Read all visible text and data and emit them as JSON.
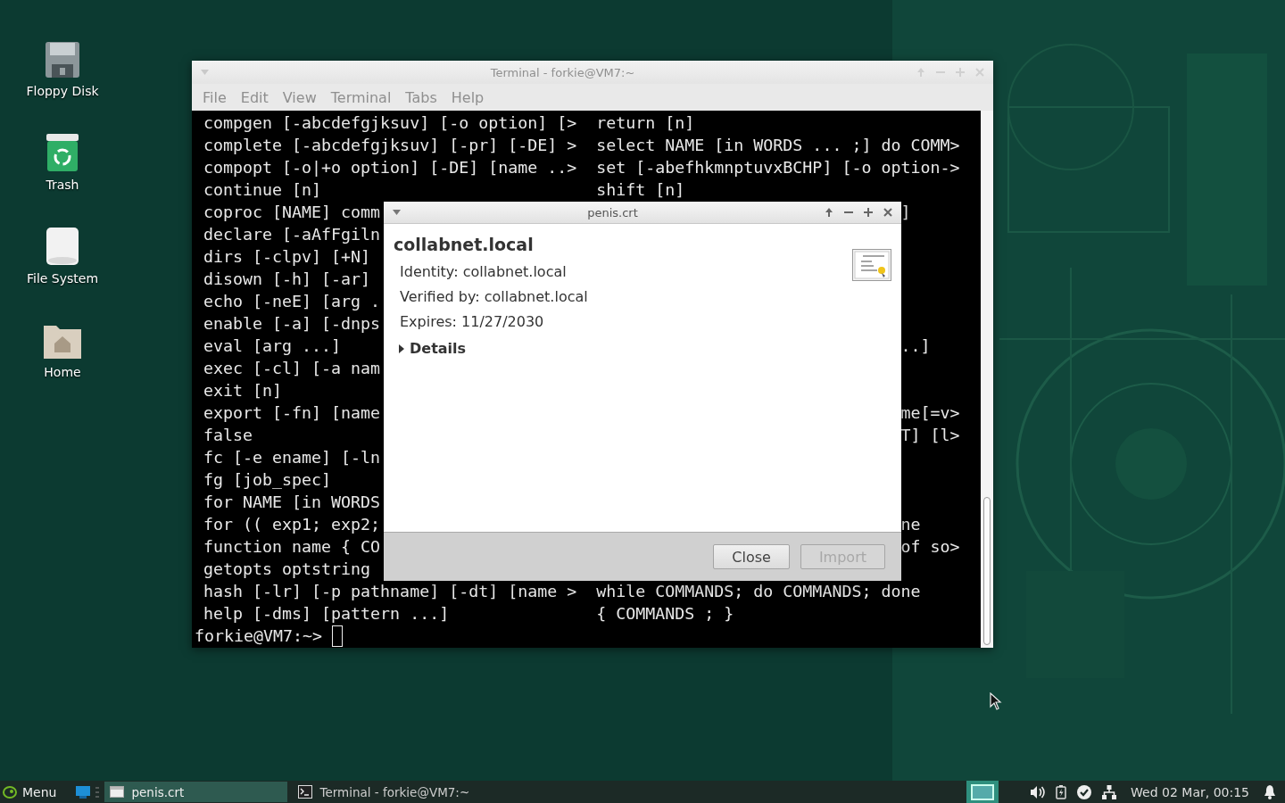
{
  "desktop": {
    "icons": [
      {
        "label": "Floppy Disk",
        "kind": "floppy"
      },
      {
        "label": "Trash",
        "kind": "trash"
      },
      {
        "label": "File System",
        "kind": "drive"
      },
      {
        "label": "Home",
        "kind": "home"
      }
    ]
  },
  "terminal_window": {
    "title": "Terminal - forkie@VM7:~",
    "active": false,
    "menu": [
      "File",
      "Edit",
      "View",
      "Terminal",
      "Tabs",
      "Help"
    ],
    "rows": [
      {
        "left": "compgen [-abcdefgjksuv] [-o option] [>",
        "right": "return [n]"
      },
      {
        "left": "complete [-abcdefgjksuv] [-pr] [-DE] >",
        "right": "select NAME [in WORDS ... ;] do COMM>"
      },
      {
        "left": "compopt [-o|+o option] [-DE] [name ..>",
        "right": "set [-abefhkmnptuvxBCHP] [-o option->"
      },
      {
        "left": "continue [n]",
        "right": "shift [n]"
      },
      {
        "left": "coproc [NAME] comm",
        "tail": "]"
      },
      {
        "left": "declare [-aAfFgiln"
      },
      {
        "left": "dirs [-clpv] [+N]"
      },
      {
        "left": "disown [-h] [-ar]"
      },
      {
        "left": "echo [-neE] [arg ."
      },
      {
        "left": "enable [-a] [-dnps"
      },
      {
        "left": "eval [arg ...]",
        "tail": "..]"
      },
      {
        "left": "exec [-cl] [-a nam"
      },
      {
        "left": "exit [n]"
      },
      {
        "left": "export [-fn] [name",
        "tail": "me[=v>"
      },
      {
        "left": "false",
        "tail": "T] [l>"
      },
      {
        "left": "fc [-e ename] [-ln"
      },
      {
        "left": "fg [job_spec]"
      },
      {
        "left": "for NAME [in WORDS"
      },
      {
        "left": "for (( exp1; exp2;",
        "tail": "ne"
      },
      {
        "left": "function name { CO",
        "tail": "of so>"
      },
      {
        "left": "getopts optstring"
      },
      {
        "left": "hash [-lr] [-p pathname] [-dt] [name >",
        "right": "while COMMANDS; do COMMANDS; done"
      },
      {
        "left": "help [-dms] [pattern ...]",
        "right": "{ COMMANDS ; }"
      }
    ],
    "prompt": "forkie@VM7:~>"
  },
  "certificate_dialog": {
    "title": "penis.crt",
    "active": true,
    "heading": "collabnet.local",
    "fields": [
      "Identity: collabnet.local",
      "Verified by: collabnet.local",
      "Expires: 11/27/2030"
    ],
    "details": {
      "label": "Details",
      "expanded": false
    },
    "buttons": [
      {
        "label": "Close",
        "disabled": false
      },
      {
        "label": "Import",
        "disabled": true
      }
    ]
  },
  "taskbar": {
    "menu_label": "Menu",
    "tasks": [
      {
        "label": "penis.crt",
        "kind": "dialog",
        "selected": true
      },
      {
        "label": "Terminal - forkie@VM7:~",
        "kind": "terminal",
        "selected": false
      }
    ],
    "clock": "Wed 02 Mar, 00:15"
  }
}
